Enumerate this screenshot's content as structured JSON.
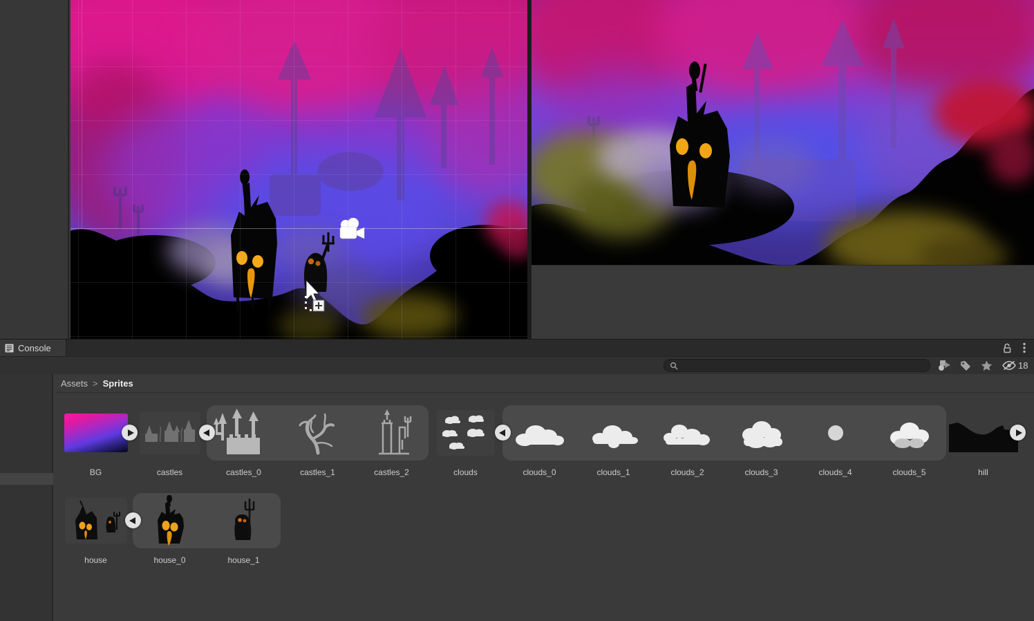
{
  "console_panel": {
    "tab_label": "Console"
  },
  "panel_icons": {
    "lock": "unlocked-padlock",
    "menu": "kebab-menu"
  },
  "search_toolbar": {
    "search_value": "",
    "search_placeholder": "",
    "filter_icons": [
      "type-filter",
      "label-tag",
      "favorites-star",
      "hidden-objects-eye"
    ],
    "hidden_objects_count": "18"
  },
  "project": {
    "breadcrumb": {
      "root": "Assets",
      "separator": ">",
      "current": "Sprites"
    },
    "row1": [
      "BG",
      "castles",
      "castles_0",
      "castles_1",
      "castles_2",
      "clouds",
      "clouds_0",
      "clouds_1",
      "clouds_2",
      "clouds_3",
      "clouds_4",
      "clouds_5",
      "hill"
    ],
    "row2": [
      "house",
      "house_0",
      "house_1"
    ]
  },
  "colors": {
    "group_selection_bg": "#4a4a4a",
    "panel_bg": "#3a3a3a",
    "eye_orange": "#f2a513",
    "sky_magenta": "#c81e8c",
    "sky_purple": "#7a42d4",
    "sky_blue": "#5a49de"
  }
}
